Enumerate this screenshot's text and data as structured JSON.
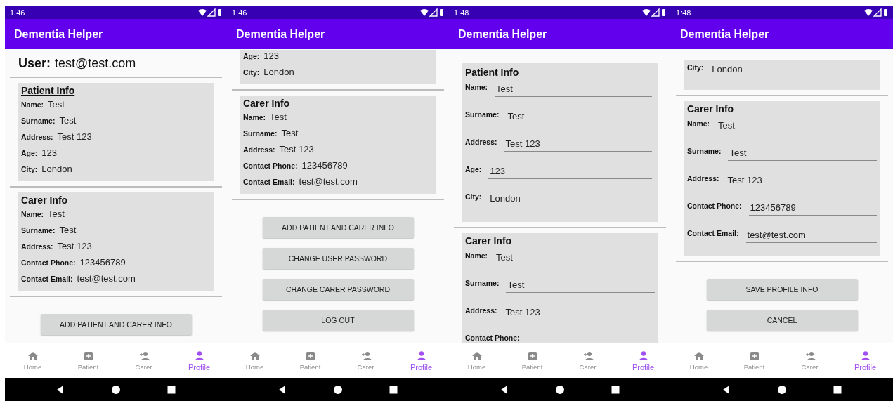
{
  "screens": [
    {
      "status_time": "1:46",
      "app_title": "Dementia Helper",
      "scrolled": false,
      "user": {
        "label": "User:",
        "email": "test@test.com"
      },
      "sections": [
        {
          "title": "Patient Info",
          "underlined": true,
          "kind": "display",
          "fields": [
            {
              "label": "Name:",
              "value": "Test"
            },
            {
              "label": "Surname:",
              "value": "Test"
            },
            {
              "label": "Address:",
              "value": "Test 123"
            },
            {
              "label": "Age:",
              "value": "123"
            },
            {
              "label": "City:",
              "value": "London"
            }
          ]
        },
        {
          "title": "Carer Info",
          "underlined": false,
          "kind": "display",
          "fields": [
            {
              "label": "Name:",
              "value": "Test"
            },
            {
              "label": "Surname:",
              "value": "Test"
            },
            {
              "label": "Address:",
              "value": "Test 123"
            },
            {
              "label": "Contact Phone:",
              "value": "123456789"
            },
            {
              "label": "Contact Email:",
              "value": "test@test.com"
            }
          ]
        }
      ],
      "buttons": [
        "ADD PATIENT AND CARER INFO"
      ],
      "nav": [
        {
          "kind": "home",
          "label": "Home",
          "selected": false
        },
        {
          "kind": "patient",
          "label": "Patient",
          "selected": false
        },
        {
          "kind": "carer",
          "label": "Carer",
          "selected": false
        },
        {
          "kind": "profile",
          "label": "Profile",
          "selected": true
        }
      ]
    },
    {
      "status_time": "1:46",
      "app_title": "Dementia Helper",
      "scrolled": true,
      "sections": [
        {
          "kind": "display",
          "fields": [
            {
              "label": "Age:",
              "value": "123"
            },
            {
              "label": "City:",
              "value": "London"
            }
          ]
        },
        {
          "title": "Carer Info",
          "underlined": false,
          "kind": "display",
          "fields": [
            {
              "label": "Name:",
              "value": "Test"
            },
            {
              "label": "Surname:",
              "value": "Test"
            },
            {
              "label": "Address:",
              "value": "Test 123"
            },
            {
              "label": "Contact Phone:",
              "value": "123456789"
            },
            {
              "label": "Contact Email:",
              "value": "test@test.com"
            }
          ]
        }
      ],
      "buttons": [
        "ADD PATIENT AND CARER INFO",
        "CHANGE USER PASSWORD",
        "CHANGE CARER PASSWORD",
        "LOG OUT"
      ],
      "nav": [
        {
          "kind": "home",
          "label": "Home",
          "selected": false
        },
        {
          "kind": "patient",
          "label": "Patient",
          "selected": false
        },
        {
          "kind": "carer",
          "label": "Carer",
          "selected": false
        },
        {
          "kind": "profile",
          "label": "Profile",
          "selected": true
        }
      ]
    },
    {
      "status_time": "1:48",
      "app_title": "Dementia Helper",
      "scrolled": false,
      "sections": [
        {
          "title": "Patient Info",
          "underlined": true,
          "kind": "form",
          "fields": [
            {
              "label": "Name:",
              "value": "Test"
            },
            {
              "label": "Surname:",
              "value": "Test"
            },
            {
              "label": "Address:",
              "value": "Test 123"
            },
            {
              "label": "Age:",
              "value": "123"
            },
            {
              "label": "City:",
              "value": "London"
            }
          ]
        },
        {
          "title": "Carer Info",
          "underlined": false,
          "kind": "form",
          "fields": [
            {
              "label": "Name:",
              "value": "Test"
            },
            {
              "label": "Surname:",
              "value": "Test"
            },
            {
              "label": "Address:",
              "value": "Test 123"
            },
            {
              "label": "Contact Phone:"
            }
          ]
        }
      ],
      "nav": [
        {
          "kind": "home",
          "label": "Home",
          "selected": false
        },
        {
          "kind": "patient",
          "label": "Patient",
          "selected": false
        },
        {
          "kind": "carer",
          "label": "Carer",
          "selected": false
        },
        {
          "kind": "profile",
          "label": "Profile",
          "selected": true
        }
      ]
    },
    {
      "status_time": "1:48",
      "app_title": "Dementia Helper",
      "scrolled": true,
      "sections": [
        {
          "kind": "form",
          "fields": [
            {
              "label": "City:",
              "value": "London"
            }
          ]
        },
        {
          "title": "Carer Info",
          "underlined": false,
          "kind": "form",
          "fields": [
            {
              "label": "Name:",
              "value": "Test"
            },
            {
              "label": "Surname:",
              "value": "Test"
            },
            {
              "label": "Address:",
              "value": "Test 123"
            },
            {
              "label": "Contact Phone:",
              "value": "123456789"
            },
            {
              "label": "Contact Email:",
              "value": "test@test.com"
            }
          ]
        }
      ],
      "buttons": [
        "SAVE PROFILE INFO",
        "CANCEL"
      ],
      "nav": [
        {
          "kind": "home",
          "label": "Home",
          "selected": false
        },
        {
          "kind": "patient",
          "label": "Patient",
          "selected": false
        },
        {
          "kind": "carer",
          "label": "Carer",
          "selected": false
        },
        {
          "kind": "profile",
          "label": "Profile",
          "selected": true
        }
      ]
    }
  ]
}
